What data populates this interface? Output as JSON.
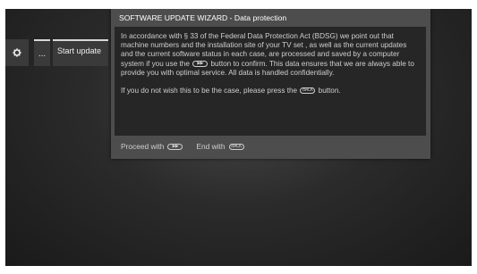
{
  "menu": {
    "gear_icon": "gear-icon",
    "more_label": "...",
    "start_update_label": "Start update"
  },
  "dialog": {
    "title": "SOFTWARE UPDATE WIZARD - Data protection",
    "paragraph1_before": "In accordance with § 33 of the Federal Data Protection Act (BDSG) we point out that machine numbers and the installation site of your TV set , as well as the current updates and the current software status in each case, are processed and saved by a computer system if you use the",
    "paragraph1_after": "button to confirm. This data ensures that we are always able to provide you with optimal service. All data is handled confidentially.",
    "paragraph2_before": "If you do not wish this to be the case, please press the",
    "paragraph2_after": "button.",
    "forward_icon": "forward-button-icon",
    "back_icon": "back-button-icon",
    "back_icon_text": "BACK"
  },
  "footer": {
    "proceed_label": "Proceed with",
    "end_label": "End with"
  }
}
